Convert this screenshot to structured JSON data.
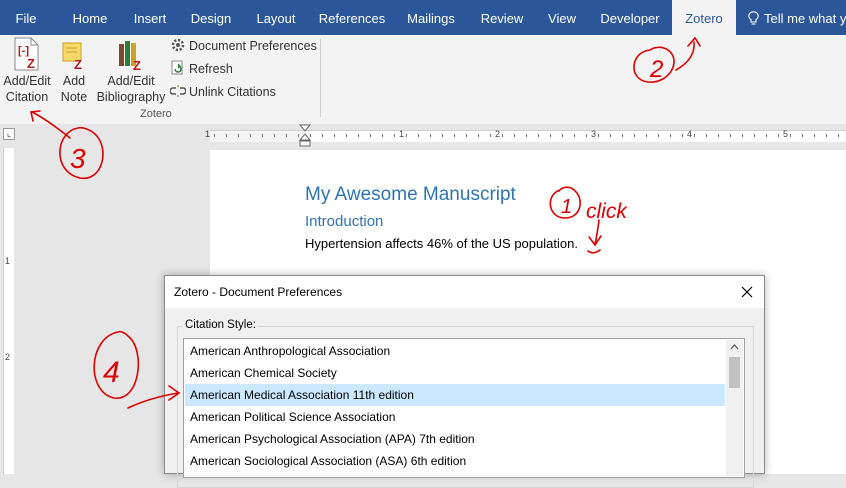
{
  "ribbon_tabs": [
    {
      "label": "File"
    },
    {
      "label": "Home"
    },
    {
      "label": "Insert"
    },
    {
      "label": "Design"
    },
    {
      "label": "Layout"
    },
    {
      "label": "References"
    },
    {
      "label": "Mailings"
    },
    {
      "label": "Review"
    },
    {
      "label": "View"
    },
    {
      "label": "Developer"
    },
    {
      "label": "Zotero",
      "active": true
    }
  ],
  "tell_me": "Tell me what yo",
  "zotero_group": {
    "name": "Zotero",
    "add_edit_citation": [
      "Add/Edit",
      "Citation"
    ],
    "add_note": [
      "Add",
      "Note"
    ],
    "add_edit_bibliography": [
      "Add/Edit",
      "Bibliography"
    ],
    "document_preferences": "Document Preferences",
    "refresh": "Refresh",
    "unlink_citations": "Unlink Citations"
  },
  "document": {
    "title": "My Awesome Manuscript",
    "heading": "Introduction",
    "body": "Hypertension affects 46% of the US population."
  },
  "dialog": {
    "title": "Zotero - Document Preferences",
    "citation_style_label": "Citation Style:",
    "styles": [
      "American Anthropological Association",
      "American Chemical Society",
      "American Medical Association 11th edition",
      "American Political Science Association",
      "American Psychological Association (APA) 7th edition",
      "American Sociological Association (ASA) 6th edition"
    ],
    "selected": "American Medical Association 11th edition"
  },
  "ruler_numbers": [
    "1",
    "1",
    "2",
    "3",
    "4",
    "5"
  ],
  "vruler_numbers": [
    "1",
    "2"
  ],
  "annotations": {
    "step1": "1",
    "click": "click",
    "step2": "2",
    "step3": "3",
    "step4": "4"
  },
  "colors": {
    "word_blue": "#2b579a",
    "heading_blue": "#2e74b5",
    "selection": "#cce8ff",
    "annotation": "#e00000"
  }
}
